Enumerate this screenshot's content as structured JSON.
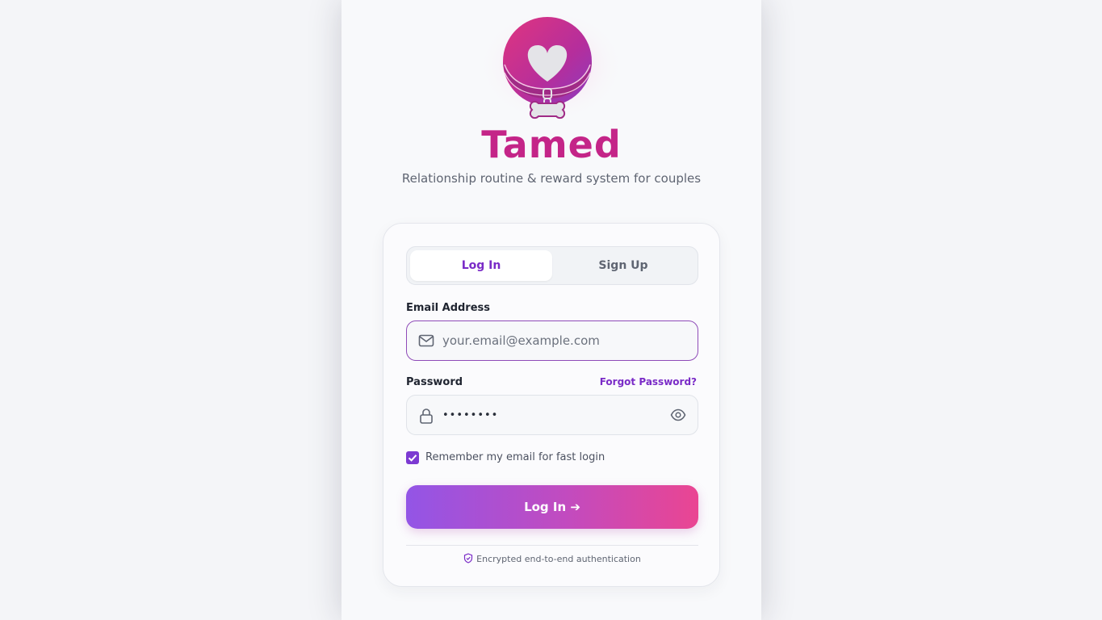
{
  "brand": {
    "name": "Tamed",
    "tagline": "Relationship routine & reward system for couples"
  },
  "auth": {
    "tabs": [
      {
        "label": "Log In",
        "active": true
      },
      {
        "label": "Sign Up",
        "active": false
      }
    ],
    "email": {
      "label": "Email Address",
      "placeholder": "your.email@example.com",
      "value": ""
    },
    "password": {
      "label": "Password",
      "value": "••••••••",
      "forgot_label": "Forgot Password?"
    },
    "remember": {
      "label": "Remember my email for fast login",
      "checked": true
    },
    "submit_label": "Log In ➔",
    "security_note": "Encrypted end-to-end authentication"
  },
  "colors": {
    "accent": "#7a2bc7",
    "brand_pink": "#c42588",
    "button_gradient_start": "#9355e6",
    "button_gradient_end": "#ea4592"
  },
  "icons": {
    "email": "mail-icon",
    "password": "lock-icon",
    "toggle": "eye-icon",
    "security": "shield-check-icon",
    "logo": "heart-collar-bone-logo"
  }
}
